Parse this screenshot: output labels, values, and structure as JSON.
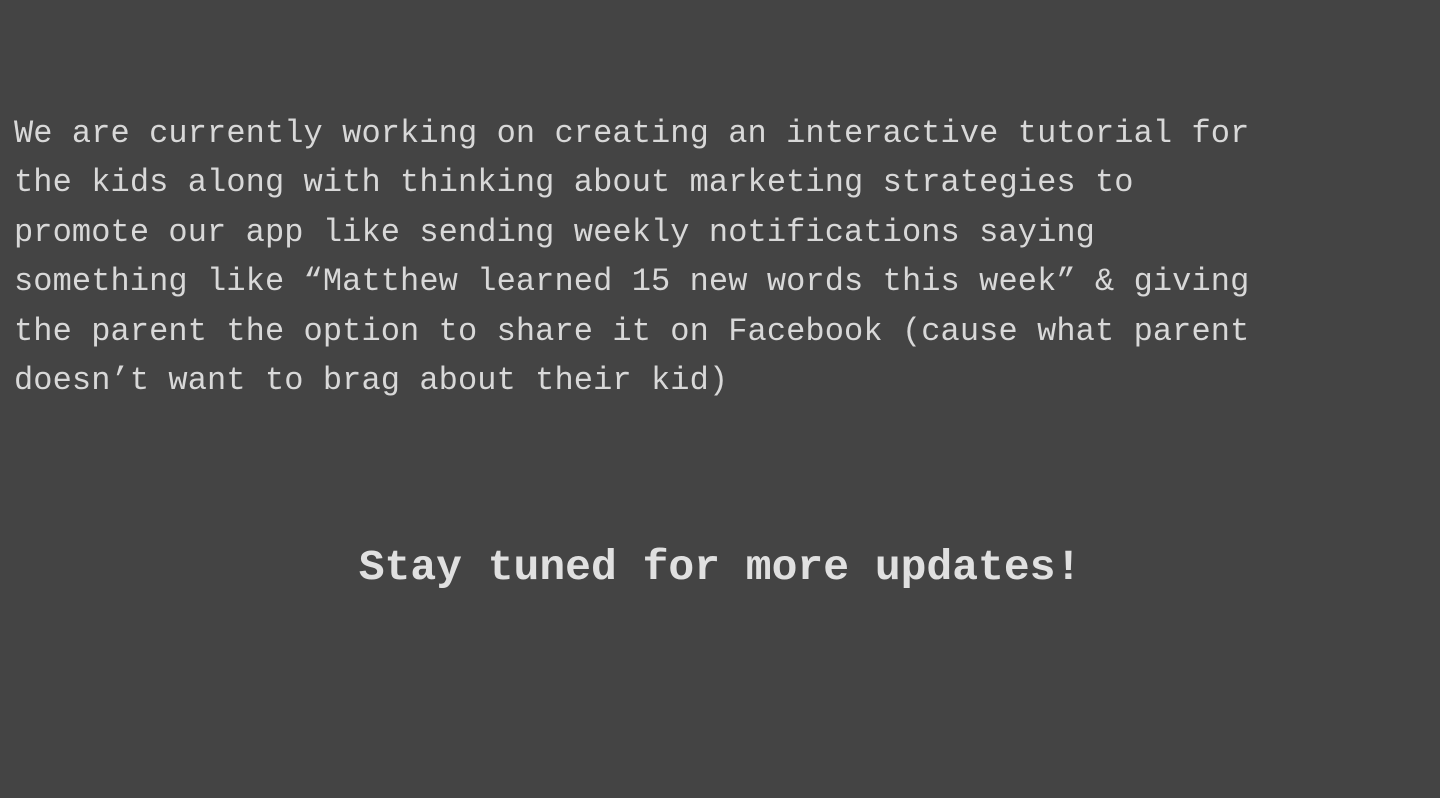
{
  "post": {
    "body_lines": [
      "We are currently working on creating an interactive tutorial for",
      "the kids along with thinking about marketing strategies to",
      "promote our app like sending weekly notifications saying",
      "something like “Matthew learned 15 new words this week” & giving",
      "the parent the option to share it on Facebook (cause what parent",
      "doesn’t want to brag about their kid)"
    ],
    "closing": "Stay tuned for more updates!"
  },
  "colors": {
    "background": "#444444",
    "text": "#d8d8d8"
  }
}
